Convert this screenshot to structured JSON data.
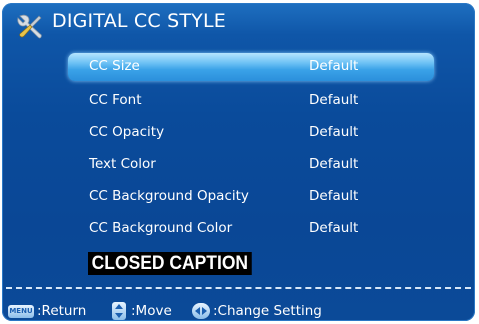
{
  "window": {
    "title": "DIGITAL CC STYLE"
  },
  "icons": {
    "title_icon": "tools-icon",
    "menu_key": "menu-key-icon",
    "move_key": "up-down-arrows-icon",
    "change_key": "left-right-arrows-icon"
  },
  "menu": {
    "items": [
      {
        "label": "CC Size",
        "value": "Default",
        "selected": true
      },
      {
        "label": "CC Font",
        "value": "Default",
        "selected": false
      },
      {
        "label": "CC Opacity",
        "value": "Default",
        "selected": false
      },
      {
        "label": "Text Color",
        "value": "Default",
        "selected": false
      },
      {
        "label": "CC Background Opacity",
        "value": "Default",
        "selected": false
      },
      {
        "label": "CC Background Color",
        "value": "Default",
        "selected": false
      }
    ]
  },
  "preview": {
    "text": "CLOSED CAPTION"
  },
  "footer": {
    "menu_key_label": "MENU",
    "return": ":Return",
    "move": ":Move",
    "change": ":Change Setting"
  },
  "colors": {
    "panel": "#0a4b9b",
    "highlight": "#3aa2e8",
    "text": "#ffffff"
  }
}
